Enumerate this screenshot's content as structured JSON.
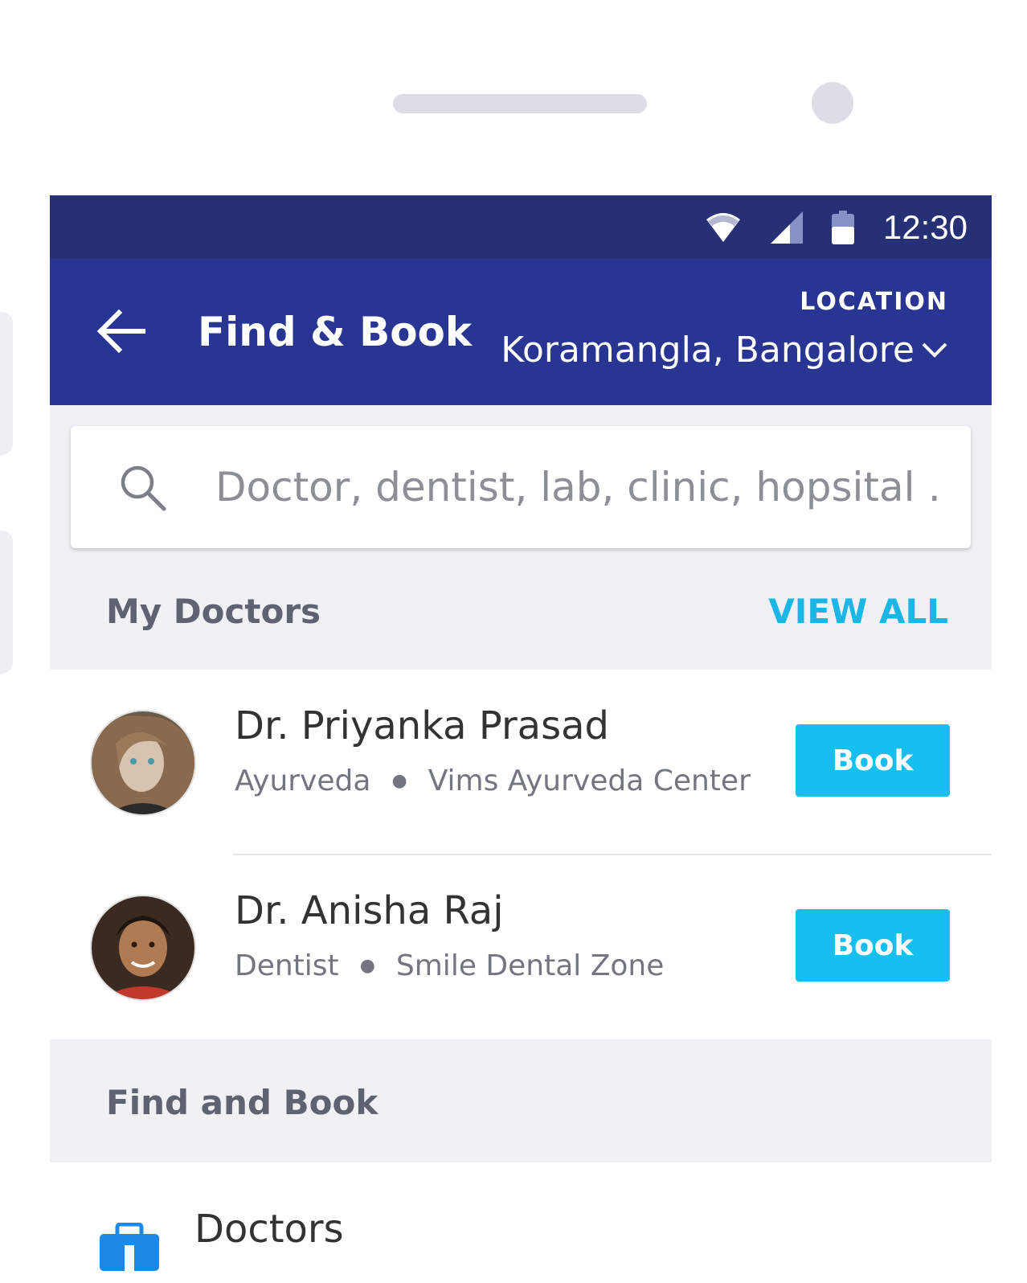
{
  "status_bar": {
    "time": "12:30"
  },
  "app_bar": {
    "title": "Find & Book",
    "location_label": "LOCATION",
    "location_value": "Koramangla, Bangalore"
  },
  "search": {
    "placeholder": "Doctor, dentist, lab, clinic, hopsital …"
  },
  "my_doctors": {
    "heading": "My Doctors",
    "view_all": "VIEW ALL",
    "doctors": [
      {
        "name": "Dr. Priyanka Prasad",
        "specialty": "Ayurveda",
        "clinic": "Vims Ayurveda Center",
        "book_label": "Book"
      },
      {
        "name": "Dr. Anisha Raj",
        "specialty": "Dentist",
        "clinic": "Smile Dental Zone",
        "book_label": "Book"
      }
    ]
  },
  "find_and_book": {
    "heading": "Find and Book",
    "items": [
      {
        "label": "Doctors",
        "icon": "medical-kit-icon"
      }
    ]
  },
  "colors": {
    "status_bar": "#253075",
    "app_bar": "#283593",
    "accent": "#17bfef",
    "view_all": "#1ab6e6"
  }
}
